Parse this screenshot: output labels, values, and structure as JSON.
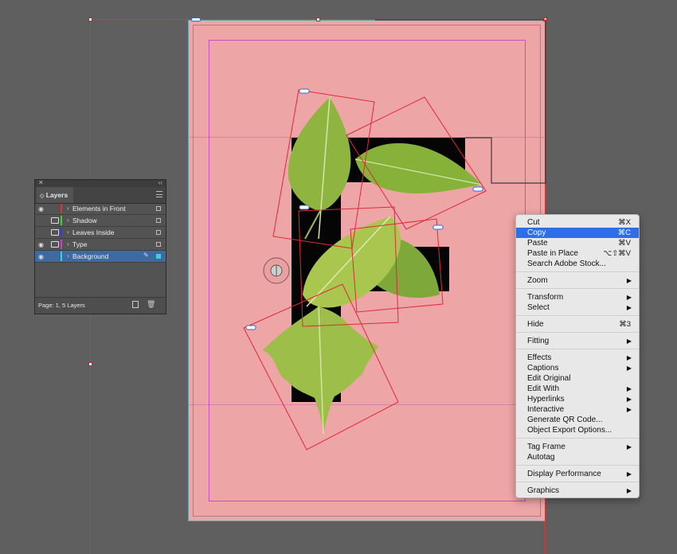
{
  "layers_panel": {
    "tab_label": "Layers",
    "layers": [
      {
        "name": "Elements in Front",
        "color": "#e03030",
        "visible": true,
        "locked": false,
        "selected": false
      },
      {
        "name": "Shadow",
        "color": "#3cd23c",
        "visible": false,
        "locked": true,
        "selected": false
      },
      {
        "name": "Leaves Inside",
        "color": "#2a3ee0",
        "visible": false,
        "locked": true,
        "selected": false
      },
      {
        "name": "Type",
        "color": "#d23cd2",
        "visible": true,
        "locked": true,
        "selected": false
      },
      {
        "name": "Background",
        "color": "#38d2d2",
        "visible": true,
        "locked": false,
        "selected": true
      }
    ],
    "footer_status": "Page: 1, 5 Layers"
  },
  "context_menu": {
    "items": [
      {
        "label": "Cut",
        "shortcut": "⌘X"
      },
      {
        "label": "Copy",
        "shortcut": "⌘C",
        "highlighted": true
      },
      {
        "label": "Paste",
        "shortcut": "⌘V"
      },
      {
        "label": "Paste in Place",
        "shortcut": "⌥⇧⌘V"
      },
      {
        "label": "Search Adobe Stock..."
      },
      {
        "separator": true
      },
      {
        "label": "Zoom",
        "submenu": true
      },
      {
        "separator": true
      },
      {
        "label": "Transform",
        "submenu": true
      },
      {
        "label": "Select",
        "submenu": true
      },
      {
        "separator": true
      },
      {
        "label": "Hide",
        "shortcut": "⌘3"
      },
      {
        "separator": true
      },
      {
        "label": "Fitting",
        "submenu": true
      },
      {
        "separator": true
      },
      {
        "label": "Effects",
        "submenu": true
      },
      {
        "label": "Captions",
        "submenu": true
      },
      {
        "label": "Edit Original"
      },
      {
        "label": "Edit With",
        "submenu": true
      },
      {
        "label": "Hyperlinks",
        "submenu": true
      },
      {
        "label": "Interactive",
        "submenu": true
      },
      {
        "label": "Generate QR Code..."
      },
      {
        "label": "Object Export Options..."
      },
      {
        "separator": true
      },
      {
        "label": "Tag Frame",
        "submenu": true
      },
      {
        "label": "Autotag"
      },
      {
        "separator": true
      },
      {
        "label": "Display Performance",
        "submenu": true
      },
      {
        "separator": true
      },
      {
        "label": "Graphics",
        "submenu": true
      }
    ]
  },
  "colors": {
    "page_fill": "#eea5a5",
    "selection": "#e0283c",
    "menu_highlight": "#2e6ee8",
    "leaf_green": "#8fb540"
  },
  "icons": {
    "visibility": "eye-icon",
    "lock": "lock-icon",
    "expand": "chevron-right-icon",
    "pen": "pen-icon",
    "new_layer": "new-layer-icon",
    "delete": "trash-icon",
    "panel_menu": "hamburger-icon",
    "submenu": "triangle-right-icon"
  }
}
